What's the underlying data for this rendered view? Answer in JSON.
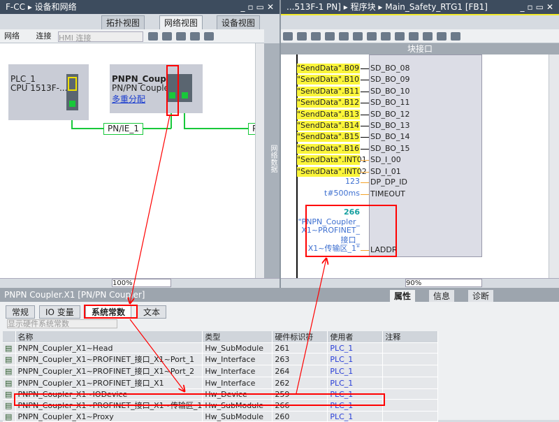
{
  "left": {
    "title": "F-CC",
    "breadcrumb": "设备和网络",
    "tabs": [
      "拓扑视图",
      "网络视图",
      "设备视图"
    ],
    "toolbar": {
      "network": "网络",
      "connect": "连接",
      "hmi_select": "HMI 连接"
    },
    "devices": [
      {
        "name": "PLC_1",
        "model": "CPU 1513F-..."
      },
      {
        "name": "PNPN_Coupl...",
        "model": "PN/PN Coupler",
        "link": "多重分配"
      }
    ],
    "network_label": "PN/IE_1",
    "network_label2": "P",
    "side_label": "网络数据",
    "zoom": "100%"
  },
  "right": {
    "title": "...513F-1 PN]",
    "breadcrumb1": "程序块",
    "breadcrumb2": "Main_Safety_RTG1 [FB1]",
    "section": "块接口",
    "params": [
      {
        "in": "\"SendData\".B09",
        "pin": "SD_BO_08"
      },
      {
        "in": "\"SendData\".B10",
        "pin": "SD_BO_09"
      },
      {
        "in": "\"SendData\".B11",
        "pin": "SD_BO_10"
      },
      {
        "in": "\"SendData\".B12",
        "pin": "SD_BO_11"
      },
      {
        "in": "\"SendData\".B13",
        "pin": "SD_BO_12"
      },
      {
        "in": "\"SendData\".B14",
        "pin": "SD_BO_13"
      },
      {
        "in": "\"SendData\".B15",
        "pin": "SD_BO_14"
      },
      {
        "in": "\"SendData\".B16",
        "pin": "SD_BO_15"
      },
      {
        "in": "\"SendData\".INT01",
        "pin": "SD_I_00"
      },
      {
        "in": "\"SendData\".INT02",
        "pin": "SD_I_01"
      }
    ],
    "dp_id_val": "123",
    "dp_id": "DP_DP_ID",
    "timeout_val": "t#500ms",
    "timeout": "TIMEOUT",
    "laddr_num": "266",
    "laddr_lines": [
      "\"PNPN_Coupler_",
      "X1~PROFINET_",
      "接口_",
      "X1~传输区_1\""
    ],
    "laddr": "LADDR",
    "zoom": "90%"
  },
  "bottom": {
    "title": "PNPN Coupler.X1 [PN/PN Coupler]",
    "right_tabs": [
      "属性",
      "信息",
      "诊断"
    ],
    "tabs": [
      "常规",
      "IO 变量",
      "系统常数",
      "文本"
    ],
    "filter": "显示硬件系统常数",
    "columns": [
      "名称",
      "类型",
      "硬件标识符",
      "使用者",
      "注释"
    ],
    "rows": [
      [
        "PNPN_Coupler_X1~Head",
        "Hw_SubModule",
        "261",
        "PLC_1",
        ""
      ],
      [
        "PNPN_Coupler_X1~PROFINET_接口_X1~Port_1",
        "Hw_Interface",
        "263",
        "PLC_1",
        ""
      ],
      [
        "PNPN_Coupler_X1~PROFINET_接口_X1~Port_2",
        "Hw_Interface",
        "264",
        "PLC_1",
        ""
      ],
      [
        "PNPN_Coupler_X1~PROFINET_接口_X1",
        "Hw_Interface",
        "262",
        "PLC_1",
        ""
      ],
      [
        "PNPN_Coupler_X1~IODevice",
        "Hw_Device",
        "259",
        "PLC_1",
        ""
      ],
      [
        "PNPN_Coupler_X1~PROFINET_接口_X1~传输区_1",
        "Hw_SubModule",
        "266",
        "PLC_1",
        ""
      ],
      [
        "PNPN_Coupler_X1~Proxy",
        "Hw_SubModule",
        "260",
        "PLC_1",
        ""
      ]
    ]
  },
  "colors": {
    "accent_red": "#ff0000",
    "network_green": "#18c83a",
    "highlight_yellow": "#fbf53a"
  }
}
